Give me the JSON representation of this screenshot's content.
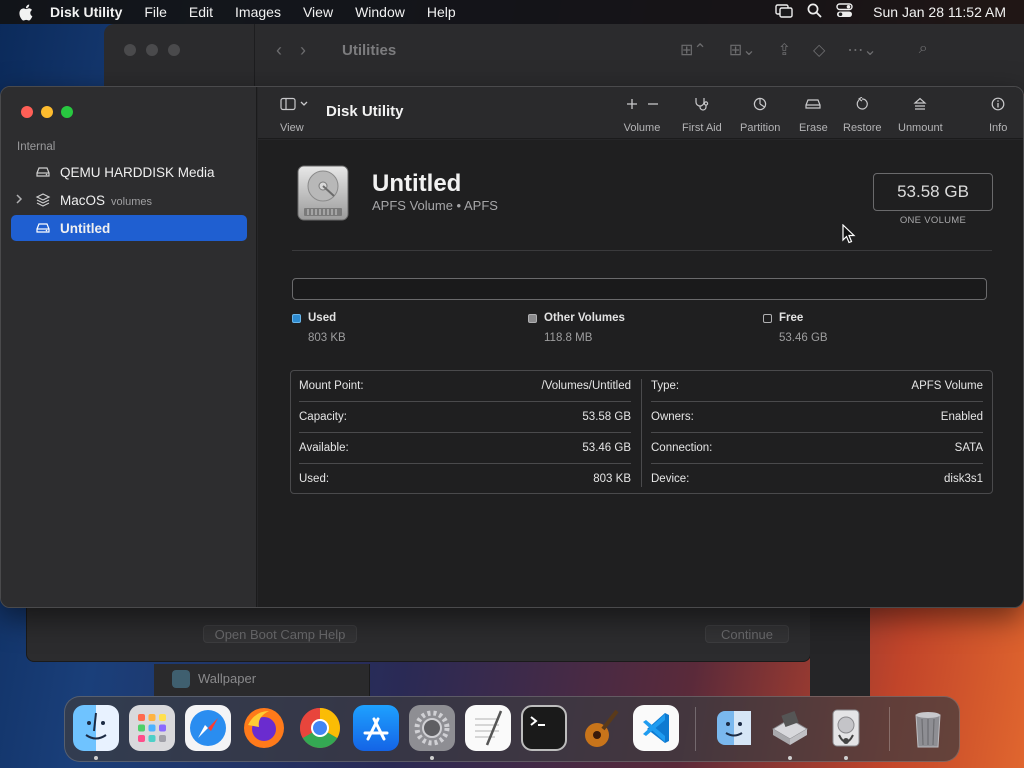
{
  "menubar": {
    "app": "Disk Utility",
    "items": [
      "File",
      "Edit",
      "Images",
      "View",
      "Window",
      "Help"
    ],
    "clock": "Sun Jan 28  11:52 AM"
  },
  "background": {
    "finder_title": "Utilities",
    "bootcamp_help": "Open Boot Camp Help",
    "bootcamp_continue": "Continue",
    "wallpaper_label": "Wallpaper"
  },
  "sidebar": {
    "section": "Internal",
    "items": [
      {
        "label": "QEMU HARDDISK Media",
        "sub": ""
      },
      {
        "label": "MacOS",
        "sub": "volumes"
      },
      {
        "label": "Untitled",
        "sub": ""
      }
    ]
  },
  "toolbar": {
    "view_label": "View",
    "title": "Disk Utility",
    "volume": "Volume",
    "first_aid": "First Aid",
    "partition": "Partition",
    "erase": "Erase",
    "restore": "Restore",
    "unmount": "Unmount",
    "info": "Info"
  },
  "volume": {
    "name": "Untitled",
    "subtitle": "APFS Volume • APFS",
    "capacity": "53.58 GB",
    "capacity_sub": "ONE VOLUME",
    "used_fraction": 0.0,
    "legend": [
      {
        "name": "Used",
        "value": "803 KB",
        "color": "#2e8bd0"
      },
      {
        "name": "Other Volumes",
        "value": "118.8 MB",
        "color": "#8a8a8c"
      },
      {
        "name": "Free",
        "value": "53.46 GB",
        "color": "#1f1f20"
      }
    ]
  },
  "info_left": [
    {
      "key": "Mount Point:",
      "value": "/Volumes/Untitled"
    },
    {
      "key": "Capacity:",
      "value": "53.58 GB"
    },
    {
      "key": "Available:",
      "value": "53.46 GB"
    },
    {
      "key": "Used:",
      "value": "803 KB"
    }
  ],
  "info_right": [
    {
      "key": "Type:",
      "value": "APFS Volume"
    },
    {
      "key": "Owners:",
      "value": "Enabled"
    },
    {
      "key": "Connection:",
      "value": "SATA"
    },
    {
      "key": "Device:",
      "value": "disk3s1"
    }
  ],
  "colors": {
    "accent": "#1f5fd1",
    "close": "#ff5f57",
    "minimize": "#febc2e",
    "zoom": "#28c840"
  },
  "dock_icons": [
    "finder-icon",
    "launchpad-icon",
    "safari-icon",
    "firefox-icon",
    "chrome-icon",
    "app-store-icon",
    "system-settings-icon",
    "textedit-icon",
    "terminal-icon",
    "garageband-icon",
    "vscode-icon",
    "migration-assistant-icon",
    "boot-camp-assistant-icon",
    "disk-utility-icon",
    "trash-icon"
  ]
}
